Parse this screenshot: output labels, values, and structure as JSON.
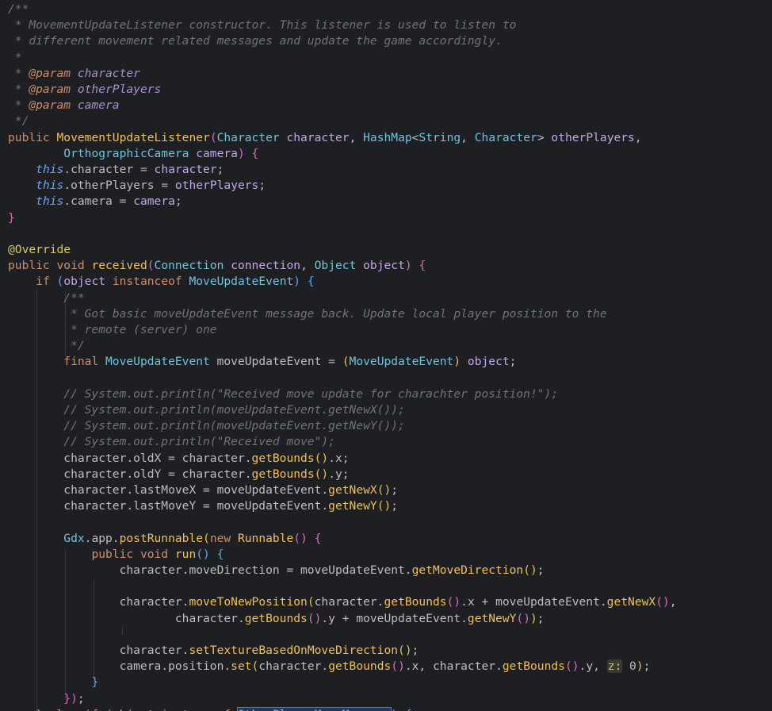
{
  "editor": {
    "language": "java",
    "colors": {
      "background": "#1e1f22",
      "keyword": "#cf8e6d",
      "type": "#6fc3df",
      "method": "#f0c05a",
      "field": "#c3a6e8",
      "comment": "#6f737a",
      "annotation": "#d6c96a",
      "text": "#bcbec4"
    },
    "lines": [
      [
        {
          "t": "/**",
          "c": "doc"
        }
      ],
      [
        {
          "t": " * MovementUpdateListener constructor. This listener is used to listen to",
          "c": "doc"
        }
      ],
      [
        {
          "t": " * different movement related messages and update the game accordingly.",
          "c": "doc"
        }
      ],
      [
        {
          "t": " *",
          "c": "doc"
        }
      ],
      [
        {
          "t": " * ",
          "c": "doc"
        },
        {
          "t": "@param",
          "c": "doctag"
        },
        {
          "t": " character",
          "c": "docparam"
        }
      ],
      [
        {
          "t": " * ",
          "c": "doc"
        },
        {
          "t": "@param",
          "c": "doctag"
        },
        {
          "t": " otherPlayers",
          "c": "docparam"
        }
      ],
      [
        {
          "t": " * ",
          "c": "doc"
        },
        {
          "t": "@param",
          "c": "doctag"
        },
        {
          "t": " camera",
          "c": "docparam"
        }
      ],
      [
        {
          "t": " */",
          "c": "doc"
        }
      ],
      [
        {
          "t": "public ",
          "c": "kw"
        },
        {
          "t": "MovementUpdateListener",
          "c": "method"
        },
        {
          "t": "(",
          "c": "pink"
        },
        {
          "t": "Character",
          "c": "type"
        },
        {
          "t": " character",
          "c": "param"
        },
        {
          "t": ", ",
          "c": "plain"
        },
        {
          "t": "HashMap",
          "c": "type"
        },
        {
          "t": "<",
          "c": "plain"
        },
        {
          "t": "String",
          "c": "type"
        },
        {
          "t": ", ",
          "c": "plain"
        },
        {
          "t": "Character",
          "c": "type"
        },
        {
          "t": "> ",
          "c": "plain"
        },
        {
          "t": "otherPlayers",
          "c": "param"
        },
        {
          "t": ",",
          "c": "plain"
        }
      ],
      [
        {
          "t": "        ",
          "c": "plain"
        },
        {
          "t": "OrthographicCamera",
          "c": "type"
        },
        {
          "t": " camera",
          "c": "param"
        },
        {
          "t": ") ",
          "c": "pink"
        },
        {
          "t": "{",
          "c": "pink"
        }
      ],
      [
        {
          "t": "    ",
          "c": "plain"
        },
        {
          "t": "this",
          "c": "this"
        },
        {
          "t": ".character = ",
          "c": "plain"
        },
        {
          "t": "character",
          "c": "param"
        },
        {
          "t": ";",
          "c": "plain"
        }
      ],
      [
        {
          "t": "    ",
          "c": "plain"
        },
        {
          "t": "this",
          "c": "this"
        },
        {
          "t": ".otherPlayers = ",
          "c": "plain"
        },
        {
          "t": "otherPlayers",
          "c": "param"
        },
        {
          "t": ";",
          "c": "plain"
        }
      ],
      [
        {
          "t": "    ",
          "c": "plain"
        },
        {
          "t": "this",
          "c": "this"
        },
        {
          "t": ".camera = ",
          "c": "plain"
        },
        {
          "t": "camera",
          "c": "param"
        },
        {
          "t": ";",
          "c": "plain"
        }
      ],
      [
        {
          "t": "}",
          "c": "pink"
        }
      ],
      [],
      [
        {
          "t": "@Override",
          "c": "anno"
        }
      ],
      [
        {
          "t": "public void ",
          "c": "kw"
        },
        {
          "t": "received",
          "c": "method"
        },
        {
          "t": "(",
          "c": "pink"
        },
        {
          "t": "Connection",
          "c": "type"
        },
        {
          "t": " connection",
          "c": "param"
        },
        {
          "t": ", ",
          "c": "plain"
        },
        {
          "t": "Object",
          "c": "type"
        },
        {
          "t": " object",
          "c": "param"
        },
        {
          "t": ") {",
          "c": "pink"
        }
      ],
      [
        {
          "t": "    ",
          "c": "plain"
        },
        {
          "t": "if ",
          "c": "kw"
        },
        {
          "t": "(",
          "c": "blue"
        },
        {
          "t": "object",
          "c": "param"
        },
        {
          "t": " instanceof ",
          "c": "kw"
        },
        {
          "t": "MoveUpdateEvent",
          "c": "type"
        },
        {
          "t": ") {",
          "c": "blue"
        }
      ],
      [
        {
          "t": "        /**",
          "c": "doc"
        }
      ],
      [
        {
          "t": "         * Got basic moveUpdateEvent message back. Update local player position to the",
          "c": "doc"
        }
      ],
      [
        {
          "t": "         * remote (server) one",
          "c": "doc"
        }
      ],
      [
        {
          "t": "         */",
          "c": "doc"
        }
      ],
      [
        {
          "t": "        ",
          "c": "plain"
        },
        {
          "t": "final ",
          "c": "kw"
        },
        {
          "t": "MoveUpdateEvent",
          "c": "type"
        },
        {
          "t": " moveUpdateEvent = ",
          "c": "plain"
        },
        {
          "t": "(",
          "c": "yellowb"
        },
        {
          "t": "MoveUpdateEvent",
          "c": "type"
        },
        {
          "t": ") ",
          "c": "yellowb"
        },
        {
          "t": "object",
          "c": "param"
        },
        {
          "t": ";",
          "c": "plain"
        }
      ],
      [],
      [
        {
          "t": "        // System.out.println(\"Received move update for charachter position!\");",
          "c": "comment"
        }
      ],
      [
        {
          "t": "        // System.out.println(moveUpdateEvent.getNewX());",
          "c": "comment"
        }
      ],
      [
        {
          "t": "        // System.out.println(moveUpdateEvent.getNewY());",
          "c": "comment"
        }
      ],
      [
        {
          "t": "        // System.out.println(\"Received move\");",
          "c": "comment"
        }
      ],
      [
        {
          "t": "        character.oldX = character.",
          "c": "plain"
        },
        {
          "t": "getBounds",
          "c": "method"
        },
        {
          "t": "()",
          "c": "yellowb"
        },
        {
          "t": ".x;",
          "c": "plain"
        }
      ],
      [
        {
          "t": "        character.oldY = character.",
          "c": "plain"
        },
        {
          "t": "getBounds",
          "c": "method"
        },
        {
          "t": "()",
          "c": "yellowb"
        },
        {
          "t": ".y;",
          "c": "plain"
        }
      ],
      [
        {
          "t": "        character.lastMoveX = moveUpdateEvent.",
          "c": "plain"
        },
        {
          "t": "getNewX",
          "c": "method"
        },
        {
          "t": "()",
          "c": "yellowb"
        },
        {
          "t": ";",
          "c": "plain"
        }
      ],
      [
        {
          "t": "        character.lastMoveY = moveUpdateEvent.",
          "c": "plain"
        },
        {
          "t": "getNewY",
          "c": "method"
        },
        {
          "t": "()",
          "c": "yellowb"
        },
        {
          "t": ";",
          "c": "plain"
        }
      ],
      [],
      [
        {
          "t": "        ",
          "c": "plain"
        },
        {
          "t": "Gdx",
          "c": "type"
        },
        {
          "t": ".app.",
          "c": "plain"
        },
        {
          "t": "postRunnable",
          "c": "method"
        },
        {
          "t": "(",
          "c": "yellowb"
        },
        {
          "t": "new ",
          "c": "kw"
        },
        {
          "t": "Runnable",
          "c": "method"
        },
        {
          "t": "() {",
          "c": "pink"
        }
      ],
      [
        {
          "t": "            ",
          "c": "plain"
        },
        {
          "t": "public void ",
          "c": "kw"
        },
        {
          "t": "run",
          "c": "method"
        },
        {
          "t": "() {",
          "c": "blue"
        }
      ],
      [
        {
          "t": "                character.moveDirection = moveUpdateEvent.",
          "c": "plain"
        },
        {
          "t": "getMoveDirection",
          "c": "method"
        },
        {
          "t": "()",
          "c": "yellowb"
        },
        {
          "t": ";",
          "c": "plain"
        }
      ],
      [],
      [
        {
          "t": "                character.",
          "c": "plain"
        },
        {
          "t": "moveToNewPosition",
          "c": "method"
        },
        {
          "t": "(",
          "c": "yellowb"
        },
        {
          "t": "character.",
          "c": "plain"
        },
        {
          "t": "getBounds",
          "c": "method"
        },
        {
          "t": "()",
          "c": "pink"
        },
        {
          "t": ".x + moveUpdateEvent.",
          "c": "plain"
        },
        {
          "t": "getNewX",
          "c": "method"
        },
        {
          "t": "()",
          "c": "pink"
        },
        {
          "t": ",",
          "c": "plain"
        }
      ],
      [
        {
          "t": "                        character.",
          "c": "plain"
        },
        {
          "t": "getBounds",
          "c": "method"
        },
        {
          "t": "()",
          "c": "pink"
        },
        {
          "t": ".y + moveUpdateEvent.",
          "c": "plain"
        },
        {
          "t": "getNewY",
          "c": "method"
        },
        {
          "t": "()",
          "c": "pink"
        },
        {
          "t": ")",
          "c": "yellowb"
        },
        {
          "t": ";",
          "c": "plain"
        }
      ],
      [],
      [
        {
          "t": "                character.",
          "c": "plain"
        },
        {
          "t": "setTextureBasedOnMoveDirection",
          "c": "method"
        },
        {
          "t": "()",
          "c": "yellowb"
        },
        {
          "t": ";",
          "c": "plain"
        }
      ],
      [
        {
          "t": "                camera.position.",
          "c": "plain"
        },
        {
          "t": "set",
          "c": "method"
        },
        {
          "t": "(",
          "c": "yellowb"
        },
        {
          "t": "character.",
          "c": "plain"
        },
        {
          "t": "getBounds",
          "c": "method"
        },
        {
          "t": "()",
          "c": "pink"
        },
        {
          "t": ".x, character.",
          "c": "plain"
        },
        {
          "t": "getBounds",
          "c": "method"
        },
        {
          "t": "()",
          "c": "pink"
        },
        {
          "t": ".y, ",
          "c": "plain"
        },
        {
          "t": "z:",
          "c": "hint"
        },
        {
          "t": " 0",
          "c": "plain"
        },
        {
          "t": ")",
          "c": "yellowb"
        },
        {
          "t": ";",
          "c": "plain"
        }
      ],
      [
        {
          "t": "            ",
          "c": "plain"
        },
        {
          "t": "}",
          "c": "blue"
        }
      ],
      [
        {
          "t": "        ",
          "c": "plain"
        },
        {
          "t": "})",
          "c": "pink"
        },
        {
          "t": ";",
          "c": "plain"
        }
      ],
      [
        {
          "t": "    } ",
          "c": "blue"
        },
        {
          "t": "else if ",
          "c": "kw"
        },
        {
          "t": "(",
          "c": "blue"
        },
        {
          "t": "object",
          "c": "param"
        },
        {
          "t": " instanceof ",
          "c": "kw"
        },
        {
          "t": "OtherPlayerMoveMessage",
          "c": "highlight"
        },
        {
          "t": ") {",
          "c": "blue"
        }
      ]
    ]
  }
}
